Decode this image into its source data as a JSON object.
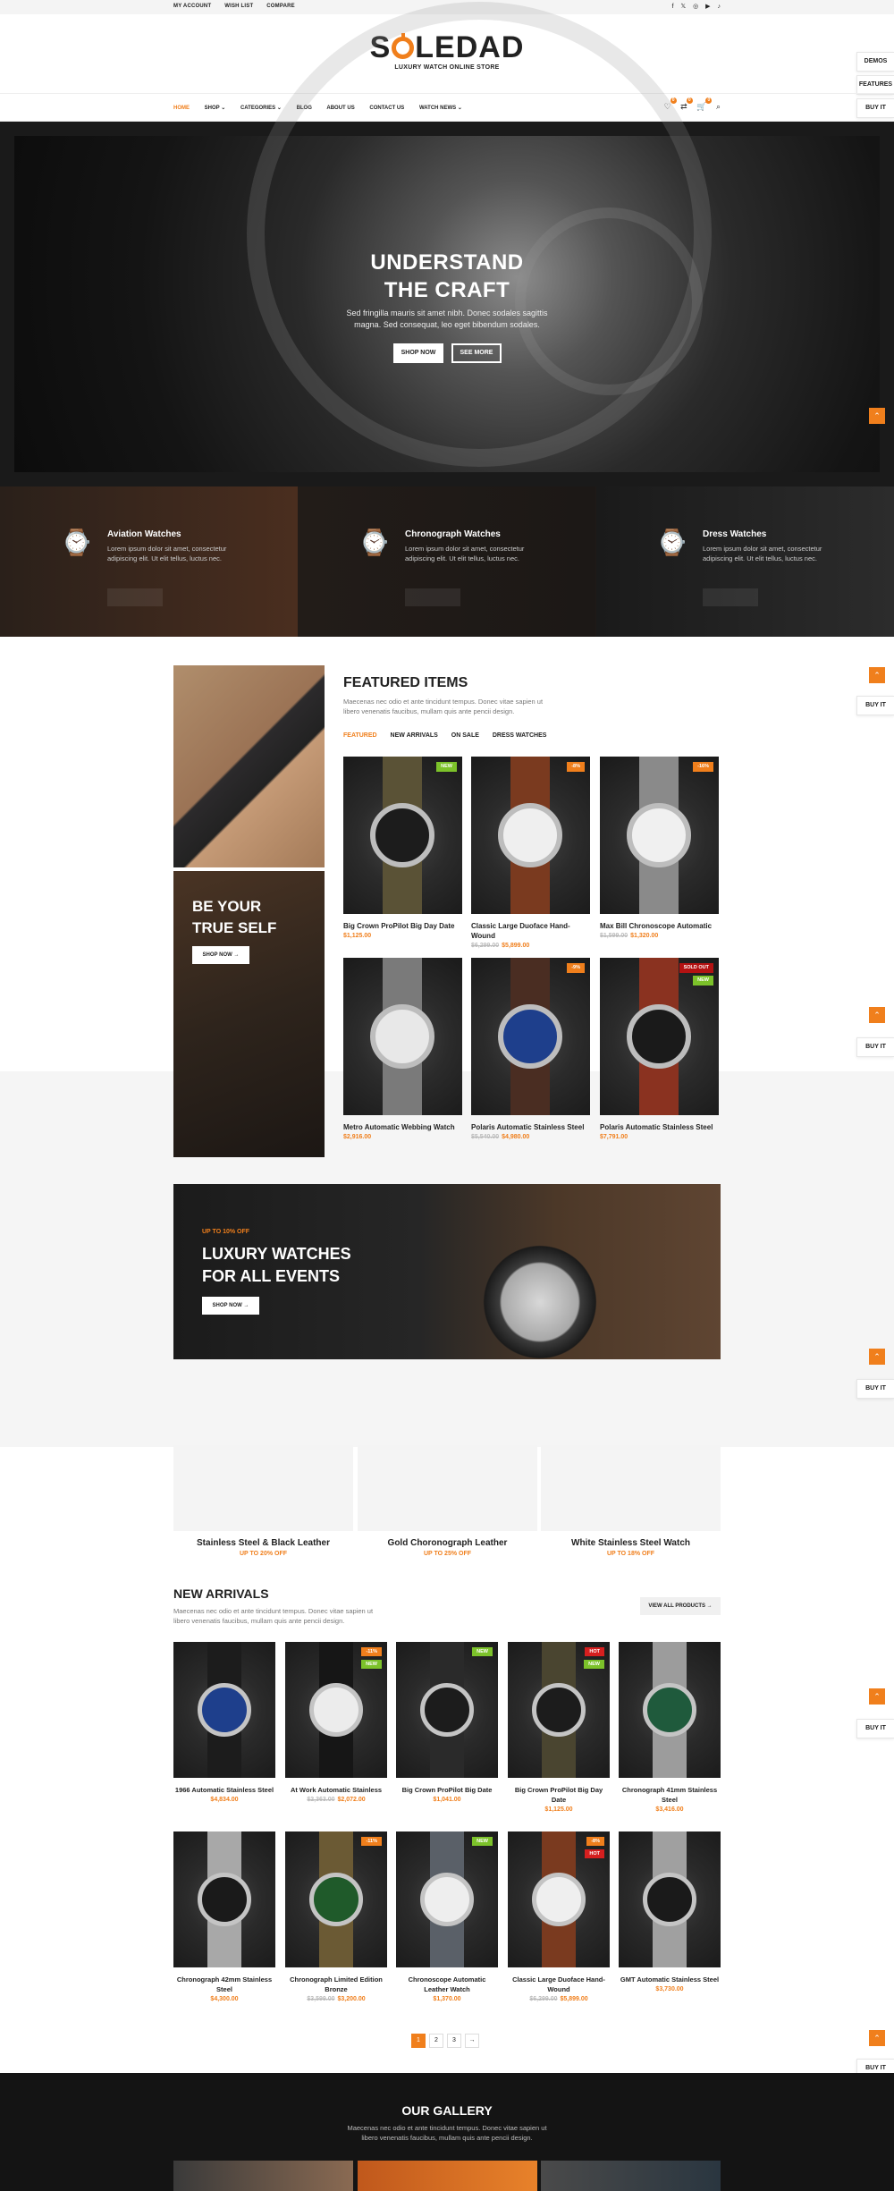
{
  "topbar": {
    "links": [
      "MY ACCOUNT",
      "WISH LIST",
      "COMPARE"
    ],
    "social": [
      "facebook-icon",
      "x-icon",
      "instagram-icon",
      "youtube-icon",
      "tiktok-icon"
    ]
  },
  "logo": {
    "text_left": "S",
    "text_right": "LEDAD",
    "tagline": "LUXURY WATCH ONLINE STORE"
  },
  "side_buttons": [
    "DEMOS",
    "FEATURES",
    "BUY IT"
  ],
  "buy_it": "BUY IT",
  "nav": {
    "items": [
      "HOME",
      "SHOP",
      "CATEGORIES",
      "BLOG",
      "ABOUT US",
      "CONTACT US",
      "WATCH NEWS"
    ],
    "active": "HOME",
    "dropdown_items": [
      "SHOP",
      "CATEGORIES",
      "WATCH NEWS"
    ],
    "icons": [
      "heart-icon",
      "compare-icon",
      "cart-icon",
      "search-icon"
    ],
    "counts": [
      "0",
      "0",
      "0"
    ]
  },
  "hero": {
    "title_line1": "UNDERSTAND",
    "title_line2": "THE CRAFT",
    "text": "Sed fringilla mauris sit amet nibh. Donec sodales sagittis magna. Sed consequat, leo eget bibendum sodales.",
    "btn_shop": "SHOP NOW",
    "btn_more": "SEE MORE"
  },
  "categories": [
    {
      "title": "Aviation Watches",
      "text": "Lorem ipsum dolor sit amet, consectetur adipiscing elit. Ut elit tellus, luctus nec."
    },
    {
      "title": "Chronograph Watches",
      "text": "Lorem ipsum dolor sit amet, consectetur adipiscing elit. Ut elit tellus, luctus nec."
    },
    {
      "title": "Dress Watches",
      "text": "Lorem ipsum dolor sit amet, consectetur adipiscing elit. Ut elit tellus, luctus nec."
    }
  ],
  "be_true": {
    "line1": "BE YOUR",
    "line2": "TRUE SELF",
    "btn": "SHOP NOW"
  },
  "featured": {
    "title": "FEATURED ITEMS",
    "desc": "Maecenas nec odio et ante tincidunt tempus. Donec vitae sapien ut libero venenatis faucibus, mullam quis ante pencii design.",
    "tabs": [
      "FEATURED",
      "NEW ARRIVALS",
      "ON SALE",
      "DRESS WATCHES"
    ],
    "products": [
      {
        "name": "Big Crown ProPilot Big Day Date",
        "old": "",
        "price": "$1,125.00",
        "badges": [
          {
            "t": "NEW",
            "c": "#7cc22a"
          }
        ],
        "strap": "#5a5236",
        "face": "#1c1c1c"
      },
      {
        "name": "Classic Large Duoface Hand-Wound",
        "old": "$6,299.00",
        "price": "$5,899.00",
        "badges": [
          {
            "t": "-8%",
            "c": "#f07f1c"
          }
        ],
        "strap": "#7a3a1f",
        "face": "#efefef"
      },
      {
        "name": "Max Bill Chronoscope Automatic",
        "old": "$1,599.00",
        "price": "$1,320.00",
        "badges": [
          {
            "t": "-16%",
            "c": "#f07f1c"
          }
        ],
        "strap": "#8a8a8a",
        "face": "#f0f0f0"
      },
      {
        "name": "Metro Automatic Webbing Watch",
        "old": "",
        "price": "$2,916.00",
        "badges": [],
        "strap": "#7a7a7a",
        "face": "#e8e8e8"
      },
      {
        "name": "Polaris Automatic Stainless Steel",
        "old": "$5,540.00",
        "price": "$4,980.00",
        "badges": [
          {
            "t": "-9%",
            "c": "#f07f1c"
          }
        ],
        "strap": "#4a2d22",
        "face": "#1e3f8c"
      },
      {
        "name": "Polaris Automatic Stainless Steel",
        "old": "",
        "price": "$7,791.00",
        "badges": [
          {
            "t": "SOLD OUT",
            "c": "#b31212"
          },
          {
            "t": "NEW",
            "c": "#7cc22a"
          }
        ],
        "strap": "#8a3220",
        "face": "#1a1a1a"
      }
    ]
  },
  "banner": {
    "upto": "UP TO 10% OFF",
    "line1": "LUXURY WATCHES",
    "line2": "FOR ALL EVENTS",
    "btn": "SHOP NOW"
  },
  "promos": [
    {
      "title": "Stainless Steel & Black Leather",
      "off": "UP TO 20% OFF"
    },
    {
      "title": "Gold Choronograph Leather",
      "off": "UP TO 25% OFF"
    },
    {
      "title": "White Stainless Steel Watch",
      "off": "UP TO 18% OFF"
    }
  ],
  "new_arrivals": {
    "title": "NEW ARRIVALS",
    "desc": "Maecenas nec odio et ante tincidunt tempus. Donec vitae sapien ut libero venenatis faucibus, mullam quis ante pencii design.",
    "view_all": "VIEW ALL PRODUCTS",
    "products": [
      {
        "name": "1966 Automatic Stainless Steel",
        "old": "",
        "price": "$4,834.00",
        "badges": [],
        "strap": "#1c1c1c",
        "face": "#1e3f8c"
      },
      {
        "name": "At Work Automatic Stainless",
        "old": "$2,363.00",
        "price": "$2,072.00",
        "badges": [
          {
            "t": "-11%",
            "c": "#f07f1c"
          },
          {
            "t": "NEW",
            "c": "#7cc22a"
          }
        ],
        "strap": "#161616",
        "face": "#ececec"
      },
      {
        "name": "Big Crown ProPilot Big Date",
        "old": "",
        "price": "$1,041.00",
        "badges": [
          {
            "t": "NEW",
            "c": "#7cc22a"
          }
        ],
        "strap": "#2a2a2a",
        "face": "#1c1c1c"
      },
      {
        "name": "Big Crown ProPilot Big Day Date",
        "old": "",
        "price": "$1,125.00",
        "badges": [
          {
            "t": "HOT",
            "c": "#d61f1f"
          },
          {
            "t": "NEW",
            "c": "#7cc22a"
          }
        ],
        "strap": "#4a4530",
        "face": "#1c1c1c"
      },
      {
        "name": "Chronograph 41mm Stainless Steel",
        "old": "",
        "price": "$3,416.00",
        "badges": [],
        "strap": "#9c9c9c",
        "face": "#1f5a3c"
      },
      {
        "name": "Chronograph 42mm Stainless Steel",
        "old": "",
        "price": "$4,300.00",
        "badges": [],
        "strap": "#a8a8a8",
        "face": "#1a1a1a"
      },
      {
        "name": "Chronograph Limited Edition Bronze",
        "old": "$3,599.00",
        "price": "$3,200.00",
        "badges": [
          {
            "t": "-11%",
            "c": "#f07f1c"
          }
        ],
        "strap": "#6b5a34",
        "face": "#1f5a2a"
      },
      {
        "name": "Chronoscope Automatic Leather Watch",
        "old": "",
        "price": "$1,370.00",
        "badges": [
          {
            "t": "NEW",
            "c": "#7cc22a"
          }
        ],
        "strap": "#5a6068",
        "face": "#eeeeee"
      },
      {
        "name": "Classic Large Duoface Hand-Wound",
        "old": "$6,299.00",
        "price": "$5,899.00",
        "badges": [
          {
            "t": "-8%",
            "c": "#f07f1c"
          },
          {
            "t": "HOT",
            "c": "#d61f1f"
          }
        ],
        "strap": "#7a3a1f",
        "face": "#efefef"
      },
      {
        "name": "GMT Automatic Stainless Steel",
        "old": "",
        "price": "$3,730.00",
        "badges": [],
        "strap": "#a0a0a0",
        "face": "#1a1a1a"
      }
    ]
  },
  "pager": [
    "1",
    "2",
    "3",
    "→"
  ],
  "gallery": {
    "title": "OUR GALLERY",
    "desc": "Maecenas nec odio et ante tincidunt tempus. Donec vitae sapien ut libero venenatis faucibus, mullam quis ante pencii design."
  }
}
